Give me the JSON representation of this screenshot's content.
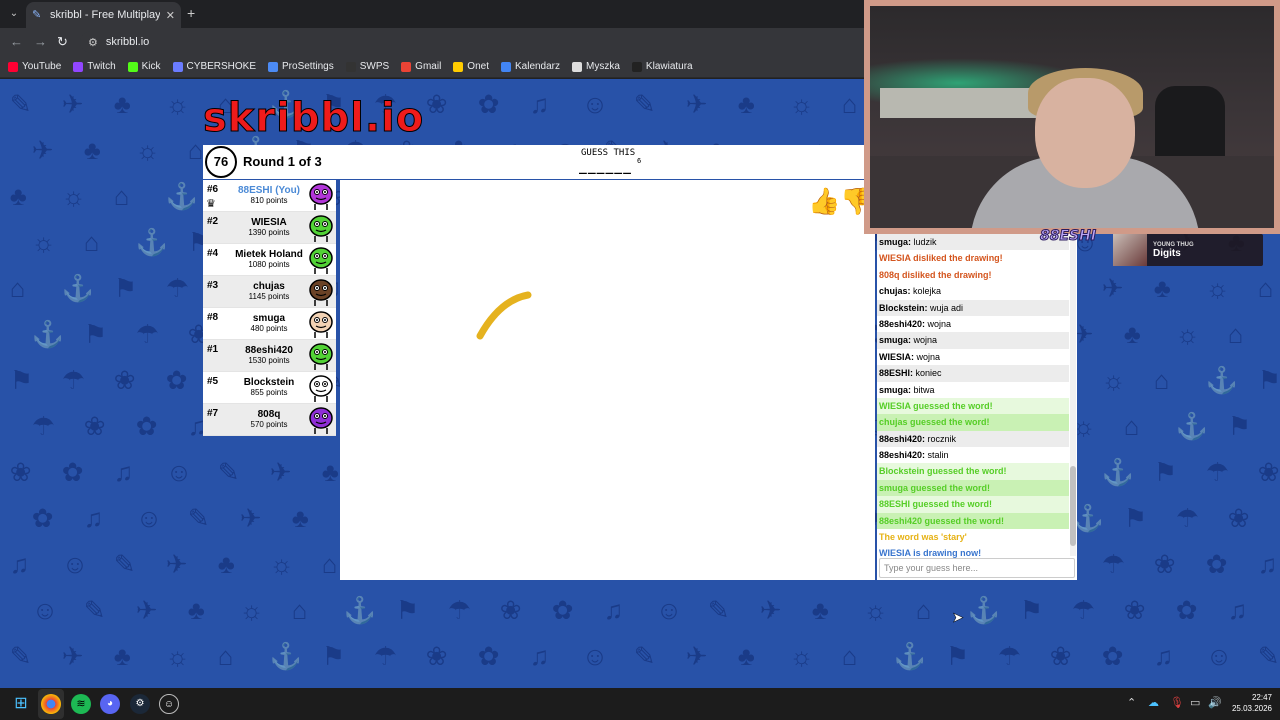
{
  "browser": {
    "tab_title": "skribbl - Free Multiplayer Draw",
    "url": "skribbl.io",
    "bookmarks": [
      {
        "label": "YouTube",
        "color": "#ff0033"
      },
      {
        "label": "Twitch",
        "color": "#9146ff"
      },
      {
        "label": "Kick",
        "color": "#53fc18"
      },
      {
        "label": "CYBERSHOKE",
        "color": "#6b7cff"
      },
      {
        "label": "ProSettings",
        "color": "#4c8bf5"
      },
      {
        "label": "SWPS",
        "color": "#333333"
      },
      {
        "label": "Gmail",
        "color": "#ea4335"
      },
      {
        "label": "Onet",
        "color": "#ffcc00"
      },
      {
        "label": "Kalendarz",
        "color": "#4285f4"
      },
      {
        "label": "Myszka",
        "color": "#dddddd"
      },
      {
        "label": "Klawiatura",
        "color": "#222222"
      }
    ]
  },
  "game": {
    "logo": "skribbl.io",
    "timer": "76",
    "round": "Round 1 of 3",
    "guess_label": "GUESS THIS",
    "word_hint": "______",
    "word_length": "6",
    "players": [
      {
        "rank": "#6",
        "name": "88ESHI (You)",
        "points": "810 points",
        "you": true,
        "avatar_color": "#b236d9"
      },
      {
        "rank": "#2",
        "name": "WIESIA",
        "points": "1390 points",
        "you": false,
        "avatar_color": "#52d236"
      },
      {
        "rank": "#4",
        "name": "Mietek Holand",
        "points": "1080 points",
        "you": false,
        "avatar_color": "#52d236"
      },
      {
        "rank": "#3",
        "name": "chujas",
        "points": "1145 points",
        "you": false,
        "avatar_color": "#6b4226"
      },
      {
        "rank": "#8",
        "name": "smuga",
        "points": "480 points",
        "you": false,
        "avatar_color": "#f2d2b4"
      },
      {
        "rank": "#1",
        "name": "88eshi420",
        "points": "1530 points",
        "you": false,
        "avatar_color": "#52d236"
      },
      {
        "rank": "#5",
        "name": "Blockstein",
        "points": "855 points",
        "you": false,
        "avatar_color": "#ffffff"
      },
      {
        "rank": "#7",
        "name": "808q",
        "points": "570 points",
        "you": false,
        "avatar_color": "#8f2fd6"
      }
    ],
    "chat": [
      {
        "kind": "normal",
        "user": "smuga:",
        "text": " ludzik"
      },
      {
        "kind": "red",
        "user": "",
        "text": "WIESIA disliked the drawing!"
      },
      {
        "kind": "red",
        "user": "",
        "text": "808q disliked the drawing!"
      },
      {
        "kind": "normal",
        "user": "chujas:",
        "text": " kolejka"
      },
      {
        "kind": "normal",
        "user": "Blockstein:",
        "text": " wuja adi"
      },
      {
        "kind": "normal",
        "user": "88eshi420:",
        "text": " wojna"
      },
      {
        "kind": "normal",
        "user": "smuga:",
        "text": " wojna"
      },
      {
        "kind": "normal",
        "user": "WIESIA:",
        "text": " wojna"
      },
      {
        "kind": "normal",
        "user": "88ESHI:",
        "text": " koniec"
      },
      {
        "kind": "normal",
        "user": "smuga:",
        "text": " bitwa"
      },
      {
        "kind": "green",
        "user": "",
        "text": "WIESIA guessed the word!"
      },
      {
        "kind": "green",
        "user": "",
        "text": "chujas guessed the word!"
      },
      {
        "kind": "normal",
        "user": "88eshi420:",
        "text": " rocznik"
      },
      {
        "kind": "normal",
        "user": "88eshi420:",
        "text": " stalin"
      },
      {
        "kind": "green",
        "user": "",
        "text": "Blockstein guessed the word!"
      },
      {
        "kind": "green",
        "user": "",
        "text": "smuga guessed the word!"
      },
      {
        "kind": "green",
        "user": "",
        "text": "88ESHI guessed the word!"
      },
      {
        "kind": "green",
        "user": "",
        "text": "88eshi420 guessed the word!"
      },
      {
        "kind": "orange",
        "user": "",
        "text": "The word was 'stary'"
      },
      {
        "kind": "blue",
        "user": "",
        "text": "WIESIA is drawing now!"
      }
    ],
    "chat_placeholder": "Type your guess here...",
    "like_icon": "thumbs-up-icon",
    "dislike_icon": "thumbs-down-icon"
  },
  "overlay": {
    "streamer_name": "88ESHI",
    "music_artist": "YOUNG THUG",
    "music_track": "Digits"
  },
  "taskbar": {
    "time": "22:47",
    "date": "25.03.2026"
  }
}
